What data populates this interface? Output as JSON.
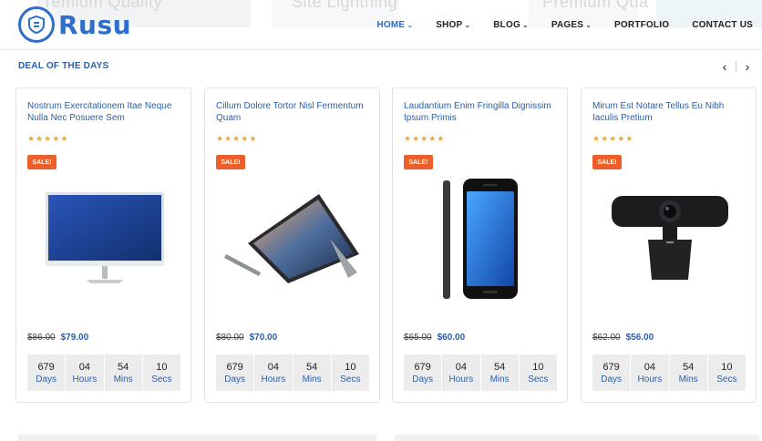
{
  "header": {
    "logo_text": "Rusu",
    "nav": [
      {
        "label": "HOME",
        "caret": "⌄",
        "active": true
      },
      {
        "label": "SHOP",
        "caret": "⌄"
      },
      {
        "label": "BLOG",
        "caret": "⌄"
      },
      {
        "label": "PAGES",
        "caret": "⌄"
      },
      {
        "label": "PORTFOLIO",
        "caret": ""
      },
      {
        "label": "CONTACT US",
        "caret": ""
      }
    ],
    "banner_fragments": [
      "remium Quality",
      "Site Lightning",
      "Premium Qua"
    ]
  },
  "deals": {
    "title": "DEAL OF THE DAYS",
    "prev_icon": "‹",
    "next_icon": "›",
    "products": [
      {
        "title": "Nostrum Exercitationem Itae Neque Nulla Nec Posuere Sem",
        "rating": 5,
        "badge": "SALE!",
        "image": "monitor",
        "old_price": "$86.00",
        "new_price": "$79.00",
        "countdown": {
          "days": "679",
          "hours": "04",
          "mins": "54",
          "secs": "10"
        }
      },
      {
        "title": "Cillum Dolore Tortor Nisl Fermentum Quam",
        "rating": 5,
        "badge": "SALE!",
        "image": "tablet",
        "old_price": "$80.00",
        "new_price": "$70.00",
        "countdown": {
          "days": "679",
          "hours": "04",
          "mins": "54",
          "secs": "10"
        }
      },
      {
        "title": "Laudantium Enim Fringilla Dignissim Ipsum Primis",
        "rating": 5,
        "badge": "SALE!",
        "image": "phone",
        "old_price": "$65.00",
        "new_price": "$60.00",
        "countdown": {
          "days": "679",
          "hours": "04",
          "mins": "54",
          "secs": "10"
        }
      },
      {
        "title": "Mirum Est Notare Tellus Eu Nibh Iaculis Pretium",
        "rating": 5,
        "badge": "SALE!",
        "image": "webcam",
        "old_price": "$62.00",
        "new_price": "$56.00",
        "countdown": {
          "days": "679",
          "hours": "04",
          "mins": "54",
          "secs": "10"
        }
      }
    ],
    "units": {
      "days": "Days",
      "hours": "Hours",
      "mins": "Mins",
      "secs": "Secs"
    }
  },
  "colors": {
    "brand": "#2f6fc9",
    "link": "#2b5ea8",
    "sale": "#ec5f2a",
    "star": "#f5a623"
  }
}
